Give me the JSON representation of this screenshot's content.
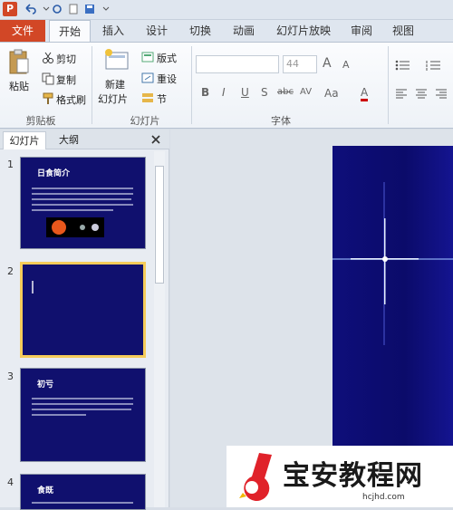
{
  "qat": {
    "app_icon": "P"
  },
  "tabs": [
    "文件",
    "开始",
    "插入",
    "设计",
    "切换",
    "动画",
    "幻灯片放映",
    "审阅",
    "视图"
  ],
  "ribbon": {
    "clipboard": {
      "paste": "粘贴",
      "cut": "剪切",
      "copy": "复制",
      "format_painter": "格式刷",
      "group": "剪贴板"
    },
    "slides": {
      "new_slide_1": "新建",
      "new_slide_2": "幻灯片",
      "layout": "版式",
      "reset": "重设",
      "section": "节",
      "group": "幻灯片"
    },
    "font": {
      "size": "44",
      "group": "字体",
      "grow": "A",
      "shrink": "A",
      "bold": "B",
      "italic": "I",
      "underline": "U",
      "shadow": "S",
      "strike": "abc",
      "spacing": "AV",
      "case": "Aa",
      "color": "A"
    }
  },
  "panel": {
    "tab_slides": "幻灯片",
    "tab_outline": "大纲",
    "slides": [
      {
        "num": "1",
        "title": "日食简介"
      },
      {
        "num": "2",
        "title": ""
      },
      {
        "num": "3",
        "title": "初亏"
      },
      {
        "num": "4",
        "title": "食既"
      }
    ]
  },
  "watermark": {
    "title": "宝安教程网",
    "url": "hcjhd.com"
  },
  "colors": {
    "file_tab": "#d24726",
    "slide_bg": "#10106e",
    "selected_border": "#f6cc5a"
  }
}
